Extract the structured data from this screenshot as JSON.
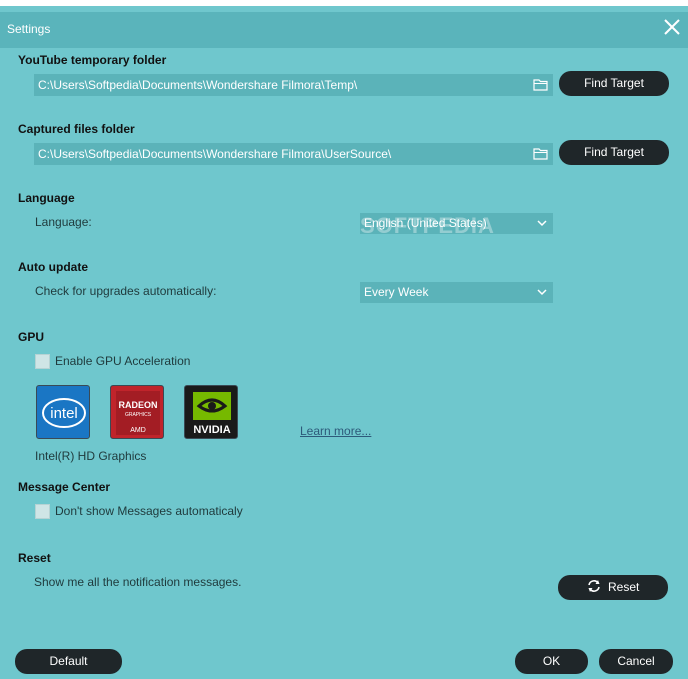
{
  "window": {
    "title": "Settings"
  },
  "youtube": {
    "section_title": "YouTube temporary folder",
    "path": "C:\\Users\\Softpedia\\Documents\\Wondershare Filmora\\Temp\\",
    "find_label": "Find Target"
  },
  "captured": {
    "section_title": "Captured files folder",
    "path": "C:\\Users\\Softpedia\\Documents\\Wondershare Filmora\\UserSource\\",
    "find_label": "Find Target"
  },
  "language": {
    "section_title": "Language",
    "label": "Language:",
    "selected": "English (United States)"
  },
  "auto_update": {
    "section_title": "Auto update",
    "label": "Check for upgrades automatically:",
    "selected": "Every Week"
  },
  "gpu": {
    "section_title": "GPU",
    "checkbox_label": "Enable GPU Acceleration",
    "checked": false,
    "cards": [
      {
        "name": "intel",
        "text": "intel"
      },
      {
        "name": "amd",
        "text_top": "RADEON",
        "text_mid": "GRAPHICS",
        "text_bottom": "AMD"
      },
      {
        "name": "nvidia",
        "text": "NVIDIA"
      }
    ],
    "learn_more": "Learn more...",
    "adapter": "Intel(R) HD Graphics"
  },
  "message_center": {
    "section_title": "Message Center",
    "checkbox_label": "Don't show Messages automaticaly",
    "checked": false
  },
  "reset": {
    "section_title": "Reset",
    "label": "Show me all the notification messages.",
    "button_label": "Reset"
  },
  "footer": {
    "default_label": "Default",
    "ok_label": "OK",
    "cancel_label": "Cancel"
  },
  "watermark": "SOFTPEDIA",
  "colors": {
    "background": "#6fc7cd",
    "titlebar": "#5ab4bb",
    "field": "#5bb3b9",
    "button": "#1f2629"
  }
}
